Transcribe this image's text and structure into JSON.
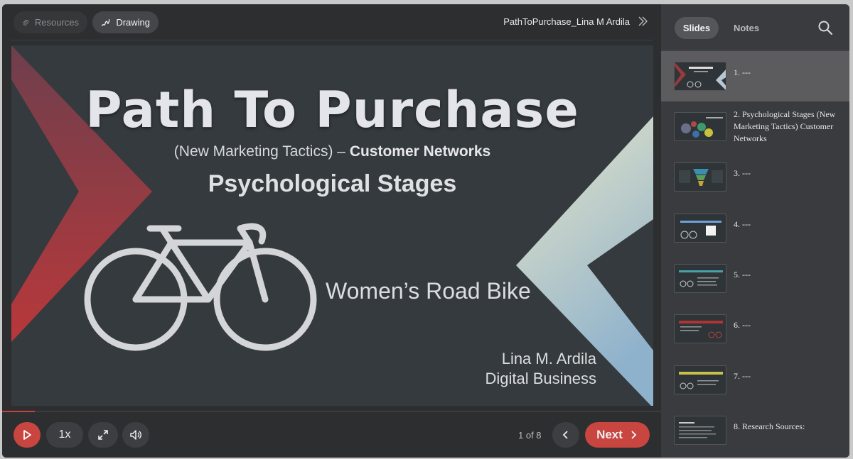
{
  "topbar": {
    "resources_label": "Resources",
    "drawing_label": "Drawing",
    "deck_title": "PathToPurchase_Lina M Ardila"
  },
  "slide": {
    "title": "Path To Purchase",
    "subtitle_plain": "(New Marketing Tactics) – ",
    "subtitle_bold": "Customer Networks",
    "subtitle2": "Psychological Stages",
    "bike_label": "Women’s Road Bike",
    "author_name": "Lina M. Ardila",
    "author_dept": "Digital Business"
  },
  "controls": {
    "speed_label": "1x",
    "page_indicator": "1 of 8",
    "next_label": "Next"
  },
  "sidebar": {
    "tab_slides": "Slides",
    "tab_notes": "Notes",
    "items": [
      {
        "label": "1. ---"
      },
      {
        "label": "2. Psychological Stages (New Marketing Tactics) Customer Networks"
      },
      {
        "label": "3. ---"
      },
      {
        "label": "4. ---"
      },
      {
        "label": "5. ---"
      },
      {
        "label": "6. ---"
      },
      {
        "label": "7. ---"
      },
      {
        "label": "8. Research Sources:"
      }
    ]
  },
  "colors": {
    "accent": "#c84540",
    "panel": "#2d2e30",
    "slide_bg": "#343a3d"
  }
}
